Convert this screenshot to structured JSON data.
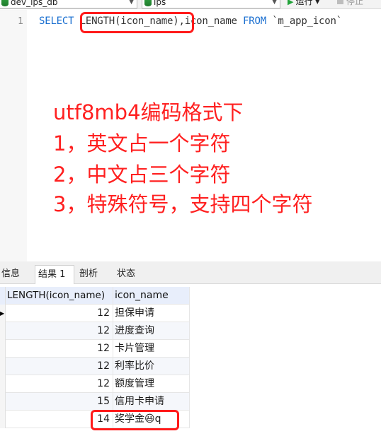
{
  "toolbar": {
    "database": "dev_ips_db",
    "schema": "ips",
    "run_label": "运行",
    "stop_label": "停止"
  },
  "editor": {
    "line_number": "1",
    "sql": {
      "kw_select": "SELECT",
      "func": "LENGTH(icon_name)",
      "rest": ",icon_name",
      "kw_from": "FROM",
      "table": "`m_app_icon`"
    },
    "notes": [
      "utf8mb4编码格式下",
      "1，英文占一个字符",
      "2，中文占三个字符",
      "3，特殊符号，支持四个字符"
    ]
  },
  "result_tabs": [
    "信息",
    "结果 1",
    "剖析",
    "状态"
  ],
  "table": {
    "columns": [
      "LENGTH(icon_name)",
      "icon_name"
    ],
    "rows": [
      {
        "length": "12",
        "icon_name": "担保申请"
      },
      {
        "length": "12",
        "icon_name": "进度查询"
      },
      {
        "length": "12",
        "icon_name": "卡片管理"
      },
      {
        "length": "12",
        "icon_name": "利率比价"
      },
      {
        "length": "12",
        "icon_name": "额度管理"
      },
      {
        "length": "15",
        "icon_name": "信用卡申请"
      },
      {
        "length": "14",
        "icon_name": "奖学金😃q"
      }
    ]
  },
  "colors": {
    "annotation": "#ff2020",
    "keyword": "#1a6fd0"
  }
}
